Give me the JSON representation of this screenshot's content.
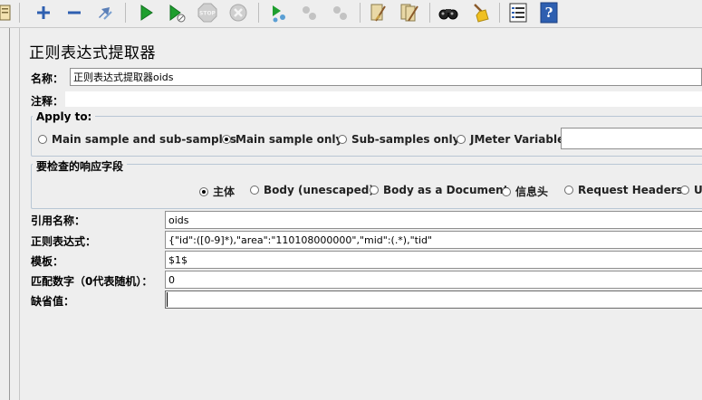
{
  "panel": {
    "title": "正则表达式提取器"
  },
  "name_row": {
    "label": "名称：",
    "value": "正则表达式提取器oids"
  },
  "comment_row": {
    "label": "注释：",
    "value": ""
  },
  "apply_to": {
    "title": "Apply to:",
    "options": [
      "Main sample and sub-samples",
      "Main sample only",
      "Sub-samples only",
      "JMeter Variable"
    ],
    "selected": "Main sample only",
    "variable_value": ""
  },
  "response_field": {
    "title": "要检查的响应字段",
    "options": [
      "主体",
      "Body (unescaped)",
      "Body as a Document",
      "信息头",
      "Request Headers",
      "U"
    ],
    "selected": "主体"
  },
  "form": {
    "ref_name": {
      "label": "引用名称：",
      "value": "oids"
    },
    "regex": {
      "label": "正则表达式：",
      "value": "{\"id\":([0-9]*),\"area\":\"110108000000\",\"mid\":(.*),\"tid\""
    },
    "template": {
      "label": "模板：",
      "value": "$1$"
    },
    "match_no": {
      "label": "匹配数字（0代表随机）：",
      "value": "0"
    },
    "default": {
      "label": "缺省值：",
      "value": ""
    }
  },
  "colors": {
    "accent_green": "#1e9e2e",
    "accent_blue": "#2e5fb0",
    "group_border": "#b8c6d4"
  },
  "toolbar_icons": [
    "template-icon",
    "expand-icon",
    "collapse-icon",
    "toggle-icon",
    "start-icon",
    "start-no-pause-icon",
    "stop-icon",
    "shutdown-icon",
    "remote-start-icon",
    "remote-stop-icon",
    "remote-shutdown-icon",
    "clear-icon",
    "clear-all-icon",
    "search-icon",
    "reset-search-icon",
    "function-helper-icon",
    "help-icon"
  ]
}
